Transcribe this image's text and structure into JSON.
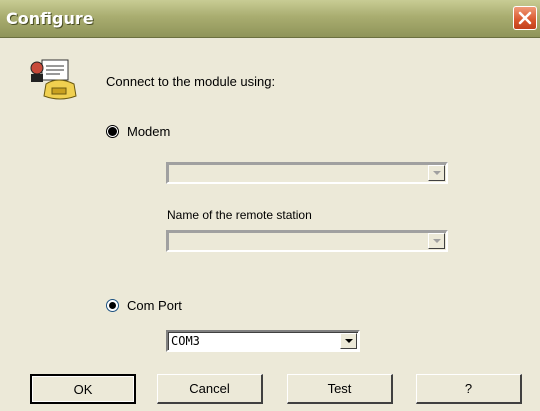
{
  "window": {
    "title": "Configure",
    "close_icon": "close-icon"
  },
  "prompt": "Connect to the module using:",
  "connection": {
    "selected": "Com Port",
    "modem": {
      "label": "Modem",
      "selected": false,
      "device_value": "",
      "remote_station_label": "Name of the remote station",
      "remote_station_value": "",
      "enabled": false
    },
    "com_port": {
      "label": "Com Port",
      "selected": true,
      "value": "COM3"
    }
  },
  "buttons": {
    "ok": "OK",
    "cancel": "Cancel",
    "test": "Test",
    "help": "?"
  },
  "icons": {
    "app": "phone-user-icon",
    "dropdown": "chevron-down-icon"
  },
  "colors": {
    "dialog_bg": "#ece9d8",
    "titlebar": "#a9ad70",
    "close_button": "#d9562c"
  }
}
